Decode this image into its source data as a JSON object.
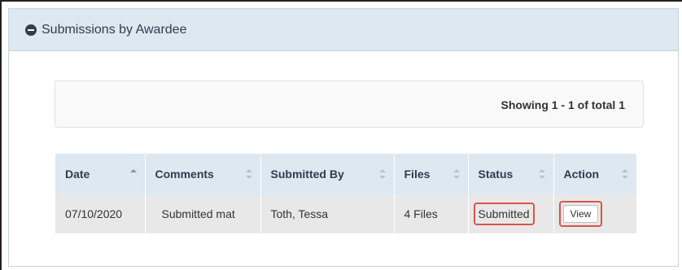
{
  "panel": {
    "title": "Submissions by Awardee"
  },
  "pagination": {
    "showing_text": "Showing 1 - 1 of total 1"
  },
  "table": {
    "headers": [
      "Date",
      "Comments",
      "Submitted By",
      "Files",
      "Status",
      "Action"
    ],
    "rows": [
      {
        "date": "07/10/2020",
        "comments": "Submitted mat",
        "submitted_by": "Toth, Tessa",
        "files": "4 Files",
        "status": "Submitted",
        "action": "View"
      }
    ]
  },
  "colors": {
    "header_bg": "#dde8f1",
    "row_bg": "#e8e8e8",
    "highlight": "#d9534f",
    "heading_text": "#2c3e50"
  },
  "icons": {
    "collapse": "minus-circle-icon",
    "sort": "sort-icon",
    "sort_active": "sort-asc-icon"
  }
}
